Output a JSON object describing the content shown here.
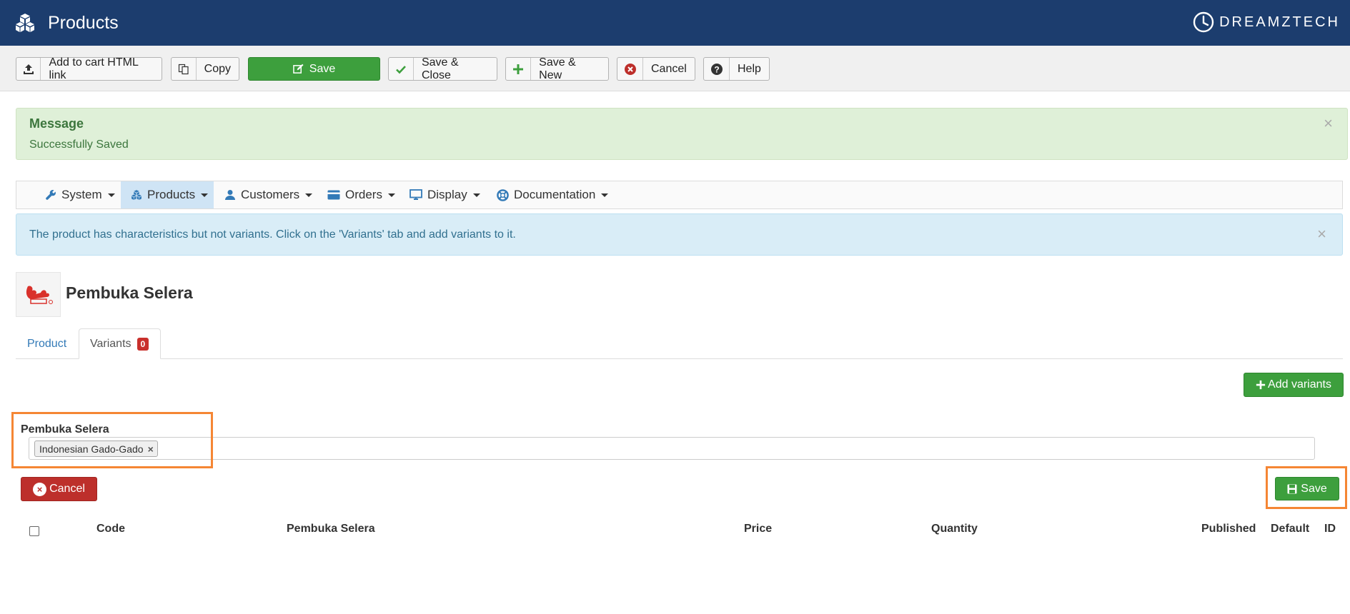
{
  "header": {
    "title": "Products",
    "brand": "DREAMZTECH"
  },
  "toolbar": {
    "add_to_cart_label": "Add to cart HTML link",
    "copy_label": "Copy",
    "save_label": "Save",
    "save_close_label": "Save & Close",
    "save_new_label": "Save & New",
    "cancel_label": "Cancel",
    "help_label": "Help"
  },
  "message": {
    "heading": "Message",
    "text": "Successfully Saved",
    "close": "×"
  },
  "menu": {
    "items": [
      {
        "label": "System",
        "icon": "wrench-icon"
      },
      {
        "label": "Products",
        "icon": "cubes-icon"
      },
      {
        "label": "Customers",
        "icon": "user-icon"
      },
      {
        "label": "Orders",
        "icon": "credit-card-icon"
      },
      {
        "label": "Display",
        "icon": "monitor-icon"
      },
      {
        "label": "Documentation",
        "icon": "lifebuoy-icon"
      }
    ],
    "active": "Products"
  },
  "info": {
    "text": "The product has characteristics but not variants. Click on the 'Variants' tab and add variants to it.",
    "close": "×"
  },
  "product": {
    "name": "Pembuka Selera"
  },
  "tabs": {
    "product_label": "Product",
    "variants_label": "Variants",
    "variants_count": "0"
  },
  "variants": {
    "add_label": "Add variants",
    "characteristic_label": "Pembuka Selera",
    "selected_chip": "Indonesian Gado-Gado",
    "chip_remove": "×",
    "cancel_label": "Cancel",
    "save_label": "Save"
  },
  "table": {
    "columns": [
      "Code",
      "Pembuka Selera",
      "Price",
      "Quantity",
      "Published",
      "Default",
      "ID"
    ]
  },
  "colors": {
    "header_bg": "#1c3d6e",
    "success_bg": "#dff0d8",
    "info_bg": "#d9edf7",
    "green": "#3d9f3d",
    "red": "#bd2f2b",
    "highlight": "#f58634"
  }
}
